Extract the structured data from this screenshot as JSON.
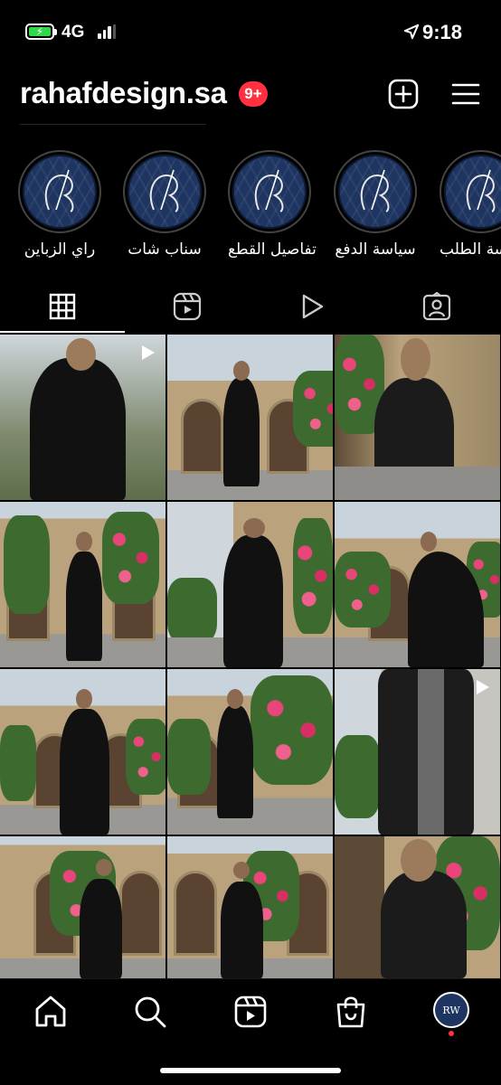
{
  "status_bar": {
    "network": "4G",
    "time": "9:18",
    "battery_color": "#32d74b"
  },
  "header": {
    "username": "rahafdesign.sa",
    "notification_badge": "9+",
    "badge_color": "#ff3040",
    "add_icon": "plus-square-icon",
    "menu_icon": "hamburger-menu-icon"
  },
  "highlights": [
    {
      "label": "راي الزباين"
    },
    {
      "label": "سناب شات"
    },
    {
      "label": "تفاصيل القطع"
    },
    {
      "label": "سياسة الدفع"
    },
    {
      "label": "سة الطلب"
    }
  ],
  "tabs": [
    {
      "icon": "grid-icon",
      "selected": true
    },
    {
      "icon": "reels-icon",
      "selected": false
    },
    {
      "icon": "video-play-icon",
      "selected": false
    },
    {
      "icon": "tagged-icon",
      "selected": false
    }
  ],
  "grid": {
    "posts": 12,
    "reel_icon_posts": [
      1,
      9
    ]
  },
  "bottom_nav": [
    {
      "icon": "home-icon"
    },
    {
      "icon": "search-icon"
    },
    {
      "icon": "reels-icon"
    },
    {
      "icon": "shopping-bag-icon"
    },
    {
      "icon": "profile-avatar"
    }
  ],
  "avatar": {
    "text": "RW"
  }
}
